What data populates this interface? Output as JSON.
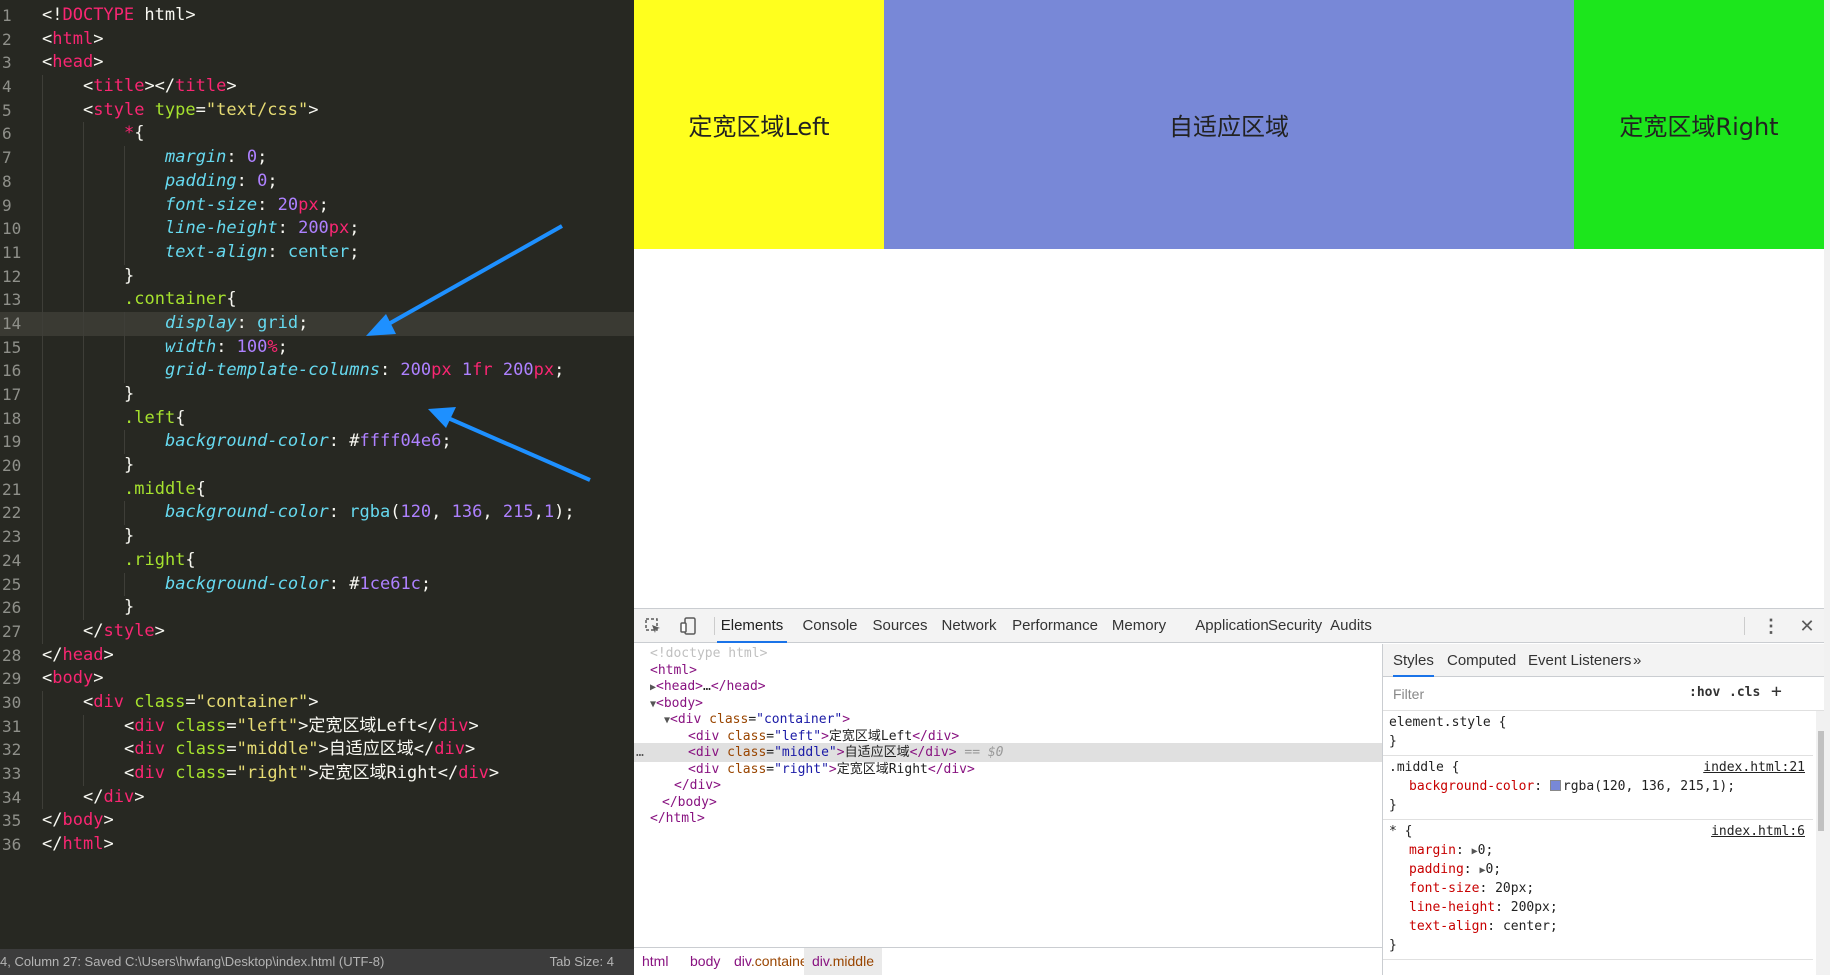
{
  "editor": {
    "lines": [
      {
        "n": "1",
        "indent": 0,
        "tokens": [
          {
            "c": "p",
            "t": "<!"
          },
          {
            "c": "tag",
            "t": "DOCTYPE"
          },
          {
            "c": "p",
            "t": " html>"
          }
        ]
      },
      {
        "n": "2",
        "indent": 0,
        "tokens": [
          {
            "c": "p",
            "t": "<"
          },
          {
            "c": "tag",
            "t": "html"
          },
          {
            "c": "p",
            "t": ">"
          }
        ]
      },
      {
        "n": "3",
        "indent": 0,
        "tokens": [
          {
            "c": "p",
            "t": "<"
          },
          {
            "c": "tag",
            "t": "head"
          },
          {
            "c": "p",
            "t": ">"
          }
        ]
      },
      {
        "n": "4",
        "indent": 1,
        "tokens": [
          {
            "c": "p",
            "t": "<"
          },
          {
            "c": "tag",
            "t": "title"
          },
          {
            "c": "p",
            "t": "></"
          },
          {
            "c": "tag",
            "t": "title"
          },
          {
            "c": "p",
            "t": ">"
          }
        ]
      },
      {
        "n": "5",
        "indent": 1,
        "tokens": [
          {
            "c": "p",
            "t": "<"
          },
          {
            "c": "tag",
            "t": "style"
          },
          {
            "c": "p",
            "t": " "
          },
          {
            "c": "attr",
            "t": "type"
          },
          {
            "c": "p",
            "t": "="
          },
          {
            "c": "str",
            "t": "\"text/css\""
          },
          {
            "c": "p",
            "t": ">"
          }
        ]
      },
      {
        "n": "6",
        "indent": 2,
        "tokens": [
          {
            "c": "kw",
            "t": "*"
          },
          {
            "c": "p",
            "t": "{"
          }
        ]
      },
      {
        "n": "7",
        "indent": 3,
        "tokens": [
          {
            "c": "prop",
            "t": "margin"
          },
          {
            "c": "p",
            "t": ": "
          },
          {
            "c": "num",
            "t": "0"
          },
          {
            "c": "p",
            "t": ";"
          }
        ]
      },
      {
        "n": "8",
        "indent": 3,
        "tokens": [
          {
            "c": "prop",
            "t": "padding"
          },
          {
            "c": "p",
            "t": ": "
          },
          {
            "c": "num",
            "t": "0"
          },
          {
            "c": "p",
            "t": ";"
          }
        ]
      },
      {
        "n": "9",
        "indent": 3,
        "tokens": [
          {
            "c": "prop",
            "t": "font-size"
          },
          {
            "c": "p",
            "t": ": "
          },
          {
            "c": "num",
            "t": "20"
          },
          {
            "c": "kw",
            "t": "px"
          },
          {
            "c": "p",
            "t": ";"
          }
        ]
      },
      {
        "n": "10",
        "indent": 3,
        "tokens": [
          {
            "c": "prop",
            "t": "line-height"
          },
          {
            "c": "p",
            "t": ": "
          },
          {
            "c": "num",
            "t": "200"
          },
          {
            "c": "kw",
            "t": "px"
          },
          {
            "c": "p",
            "t": ";"
          }
        ]
      },
      {
        "n": "11",
        "indent": 3,
        "tokens": [
          {
            "c": "prop",
            "t": "text-align"
          },
          {
            "c": "p",
            "t": ": "
          },
          {
            "c": "val",
            "t": "center"
          },
          {
            "c": "p",
            "t": ";"
          }
        ]
      },
      {
        "n": "12",
        "indent": 2,
        "tokens": [
          {
            "c": "p",
            "t": "}"
          }
        ]
      },
      {
        "n": "13",
        "indent": 2,
        "tokens": [
          {
            "c": "sel",
            "t": ".container"
          },
          {
            "c": "p",
            "t": "{"
          }
        ]
      },
      {
        "n": "14",
        "indent": 3,
        "tokens": [
          {
            "c": "prop",
            "t": "display"
          },
          {
            "c": "p",
            "t": ": "
          },
          {
            "c": "val",
            "t": "grid"
          },
          {
            "c": "p",
            "t": ";"
          }
        ],
        "current": true
      },
      {
        "n": "15",
        "indent": 3,
        "tokens": [
          {
            "c": "prop",
            "t": "width"
          },
          {
            "c": "p",
            "t": ": "
          },
          {
            "c": "num",
            "t": "100"
          },
          {
            "c": "kw",
            "t": "%"
          },
          {
            "c": "p",
            "t": ";"
          }
        ]
      },
      {
        "n": "16",
        "indent": 3,
        "tokens": [
          {
            "c": "prop",
            "t": "grid-template-columns"
          },
          {
            "c": "p",
            "t": ": "
          },
          {
            "c": "num",
            "t": "200"
          },
          {
            "c": "kw",
            "t": "px"
          },
          {
            "c": "p",
            "t": " "
          },
          {
            "c": "num",
            "t": "1"
          },
          {
            "c": "kw",
            "t": "fr"
          },
          {
            "c": "p",
            "t": " "
          },
          {
            "c": "num",
            "t": "200"
          },
          {
            "c": "kw",
            "t": "px"
          },
          {
            "c": "p",
            "t": ";"
          }
        ]
      },
      {
        "n": "17",
        "indent": 2,
        "tokens": [
          {
            "c": "p",
            "t": "}"
          }
        ]
      },
      {
        "n": "18",
        "indent": 2,
        "tokens": [
          {
            "c": "sel",
            "t": ".left"
          },
          {
            "c": "p",
            "t": "{"
          }
        ]
      },
      {
        "n": "19",
        "indent": 3,
        "tokens": [
          {
            "c": "prop",
            "t": "background-color"
          },
          {
            "c": "p",
            "t": ": "
          },
          {
            "c": "p",
            "t": "#"
          },
          {
            "c": "num",
            "t": "ffff04e6"
          },
          {
            "c": "p",
            "t": ";"
          }
        ]
      },
      {
        "n": "20",
        "indent": 2,
        "tokens": [
          {
            "c": "p",
            "t": "}"
          }
        ]
      },
      {
        "n": "21",
        "indent": 2,
        "tokens": [
          {
            "c": "sel",
            "t": ".middle"
          },
          {
            "c": "p",
            "t": "{"
          }
        ]
      },
      {
        "n": "22",
        "indent": 3,
        "tokens": [
          {
            "c": "prop",
            "t": "background-color"
          },
          {
            "c": "p",
            "t": ": "
          },
          {
            "c": "val",
            "t": "rgba"
          },
          {
            "c": "p",
            "t": "("
          },
          {
            "c": "num",
            "t": "120"
          },
          {
            "c": "p",
            "t": ", "
          },
          {
            "c": "num",
            "t": "136"
          },
          {
            "c": "p",
            "t": ", "
          },
          {
            "c": "num",
            "t": "215"
          },
          {
            "c": "p",
            "t": ","
          },
          {
            "c": "num",
            "t": "1"
          },
          {
            "c": "p",
            "t": ");"
          }
        ]
      },
      {
        "n": "23",
        "indent": 2,
        "tokens": [
          {
            "c": "p",
            "t": "}"
          }
        ]
      },
      {
        "n": "24",
        "indent": 2,
        "tokens": [
          {
            "c": "sel",
            "t": ".right"
          },
          {
            "c": "p",
            "t": "{"
          }
        ]
      },
      {
        "n": "25",
        "indent": 3,
        "tokens": [
          {
            "c": "prop",
            "t": "background-color"
          },
          {
            "c": "p",
            "t": ": "
          },
          {
            "c": "p",
            "t": "#"
          },
          {
            "c": "num",
            "t": "1ce61c"
          },
          {
            "c": "p",
            "t": ";"
          }
        ]
      },
      {
        "n": "26",
        "indent": 2,
        "tokens": [
          {
            "c": "p",
            "t": "}"
          }
        ]
      },
      {
        "n": "27",
        "indent": 1,
        "tokens": [
          {
            "c": "p",
            "t": "</"
          },
          {
            "c": "tag",
            "t": "style"
          },
          {
            "c": "p",
            "t": ">"
          }
        ]
      },
      {
        "n": "28",
        "indent": 0,
        "tokens": [
          {
            "c": "p",
            "t": "</"
          },
          {
            "c": "tag",
            "t": "head"
          },
          {
            "c": "p",
            "t": ">"
          }
        ]
      },
      {
        "n": "29",
        "indent": 0,
        "tokens": [
          {
            "c": "p",
            "t": "<"
          },
          {
            "c": "tag",
            "t": "body"
          },
          {
            "c": "p",
            "t": ">"
          }
        ]
      },
      {
        "n": "30",
        "indent": 1,
        "tokens": [
          {
            "c": "p",
            "t": "<"
          },
          {
            "c": "tag",
            "t": "div"
          },
          {
            "c": "p",
            "t": " "
          },
          {
            "c": "attr",
            "t": "class"
          },
          {
            "c": "p",
            "t": "="
          },
          {
            "c": "str",
            "t": "\"container\""
          },
          {
            "c": "p",
            "t": ">"
          }
        ]
      },
      {
        "n": "31",
        "indent": 2,
        "tokens": [
          {
            "c": "p",
            "t": "<"
          },
          {
            "c": "tag",
            "t": "div"
          },
          {
            "c": "p",
            "t": " "
          },
          {
            "c": "attr",
            "t": "class"
          },
          {
            "c": "p",
            "t": "="
          },
          {
            "c": "str",
            "t": "\"left\""
          },
          {
            "c": "p",
            "t": ">定宽区域Left</"
          },
          {
            "c": "tag",
            "t": "div"
          },
          {
            "c": "p",
            "t": ">"
          }
        ]
      },
      {
        "n": "32",
        "indent": 2,
        "tokens": [
          {
            "c": "p",
            "t": "<"
          },
          {
            "c": "tag",
            "t": "div"
          },
          {
            "c": "p",
            "t": " "
          },
          {
            "c": "attr",
            "t": "class"
          },
          {
            "c": "p",
            "t": "="
          },
          {
            "c": "str",
            "t": "\"middle\""
          },
          {
            "c": "p",
            "t": ">自适应区域</"
          },
          {
            "c": "tag",
            "t": "div"
          },
          {
            "c": "p",
            "t": ">"
          }
        ]
      },
      {
        "n": "33",
        "indent": 2,
        "tokens": [
          {
            "c": "p",
            "t": "<"
          },
          {
            "c": "tag",
            "t": "div"
          },
          {
            "c": "p",
            "t": " "
          },
          {
            "c": "attr",
            "t": "class"
          },
          {
            "c": "p",
            "t": "="
          },
          {
            "c": "str",
            "t": "\"right\""
          },
          {
            "c": "p",
            "t": ">定宽区域Right</"
          },
          {
            "c": "tag",
            "t": "div"
          },
          {
            "c": "p",
            "t": ">"
          }
        ]
      },
      {
        "n": "34",
        "indent": 1,
        "tokens": [
          {
            "c": "p",
            "t": "</"
          },
          {
            "c": "tag",
            "t": "div"
          },
          {
            "c": "p",
            "t": ">"
          }
        ]
      },
      {
        "n": "35",
        "indent": 0,
        "tokens": [
          {
            "c": "p",
            "t": "</"
          },
          {
            "c": "tag",
            "t": "body"
          },
          {
            "c": "p",
            "t": ">"
          }
        ]
      },
      {
        "n": "36",
        "indent": 0,
        "tokens": [
          {
            "c": "p",
            "t": "</"
          },
          {
            "c": "tag",
            "t": "html"
          },
          {
            "c": "p",
            "t": ">"
          }
        ]
      }
    ],
    "status": {
      "left": "4, Column 27: Saved C:\\Users\\hwfang\\Desktop\\index.html (UTF-8)",
      "tab_size": "Tab Size: 4"
    },
    "arrow_color": "#1e90ff"
  },
  "page": {
    "left_label": "定宽区域Left",
    "middle_label": "自适应区域",
    "right_label": "定宽区域Right",
    "colors": {
      "left": "#ffff1e",
      "middle": "#7888d7",
      "right": "#1ce61c"
    }
  },
  "devtools": {
    "tabs": [
      "Elements",
      "Console",
      "Sources",
      "Network",
      "Performance",
      "Memory",
      "Application",
      "Security",
      "Audits"
    ],
    "active_tab": "Elements",
    "icons": {
      "inspect": "cursor-select-icon",
      "device": "device-toolbar-icon",
      "menu": "kebab-menu-icon",
      "close": "close-icon"
    },
    "dom": {
      "doctype": "<!doctype html>",
      "html_open": "html",
      "head_collapsed": "head",
      "head_ellipsis": "…",
      "body": "body",
      "container_tag": "div",
      "class_attr": "class",
      "container_class": "\"container\"",
      "left_class": "\"left\"",
      "left_text": "定宽区域Left",
      "middle_class": "\"middle\"",
      "middle_text": "自适应区域",
      "selected_marker": " == $0",
      "right_class": "\"right\"",
      "right_text": "定宽区域Right",
      "dots": "…"
    },
    "breadcrumbs": [
      "html",
      "body",
      "div.container",
      "div.middle"
    ],
    "styles": {
      "tabs": [
        "Styles",
        "Computed",
        "Event Listeners"
      ],
      "more": "»",
      "filter_placeholder": "Filter",
      "hov": ":hov",
      "cls": ".cls",
      "add": "+",
      "element_style": "element.style {",
      "close_brace": "}",
      "middle_selector": ".middle {",
      "middle_source": "index.html:21",
      "middle_prop": "background-color",
      "middle_val": "rgba(120, 136, 215,1);",
      "star_selector": "* {",
      "star_source": "index.html:6",
      "star_props": [
        {
          "p": "margin",
          "v": "0;",
          "tri": true
        },
        {
          "p": "padding",
          "v": "0;",
          "tri": true
        },
        {
          "p": "font-size",
          "v": "20px;",
          "tri": false
        },
        {
          "p": "line-height",
          "v": "200px;",
          "tri": false
        },
        {
          "p": "text-align",
          "v": "center;",
          "tri": false
        }
      ]
    }
  }
}
